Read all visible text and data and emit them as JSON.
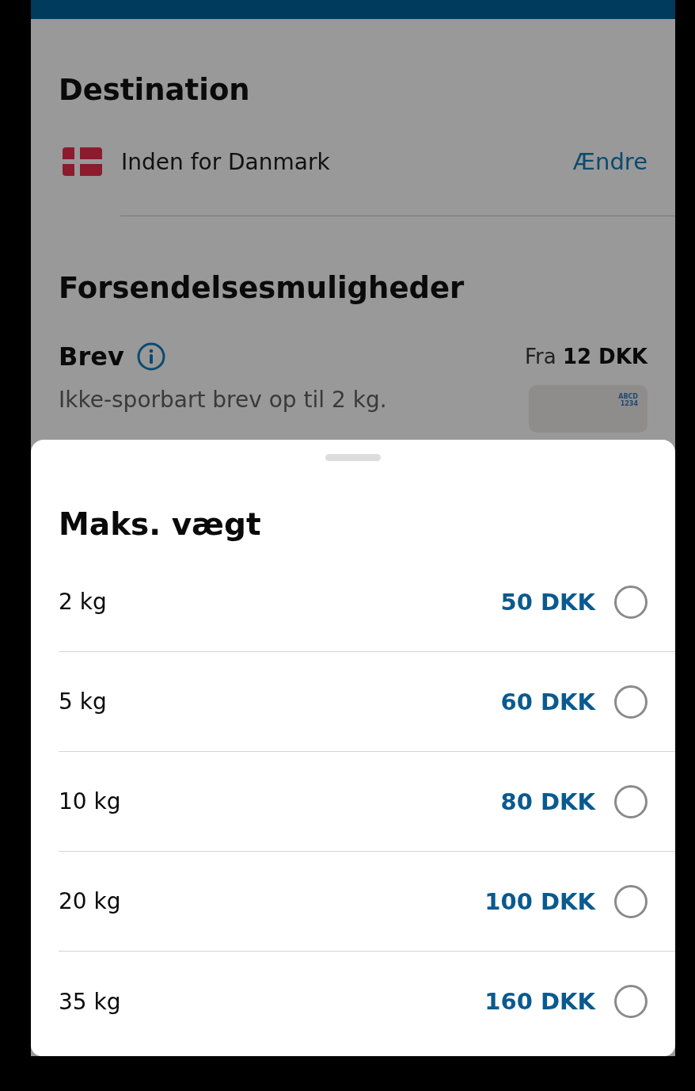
{
  "destination": {
    "title": "Destination",
    "country": "Inden for Danmark",
    "change_link": "Ændre"
  },
  "shipping": {
    "title": "Forsendelsesmuligheder",
    "option": {
      "name": "Brev",
      "price_prefix": "Fra",
      "price": "12 DKK",
      "description": "Ikke-sporbart brev op til 2 kg.",
      "label_lines": [
        "ABCD",
        "1234"
      ]
    }
  },
  "sheet": {
    "title": "Maks. vægt",
    "options": [
      {
        "weight": "2 kg",
        "price": "50 DKK",
        "selected": false
      },
      {
        "weight": "5 kg",
        "price": "60 DKK",
        "selected": false
      },
      {
        "weight": "10 kg",
        "price": "80 DKK",
        "selected": false
      },
      {
        "weight": "20 kg",
        "price": "100 DKK",
        "selected": false
      },
      {
        "weight": "35 kg",
        "price": "160 DKK",
        "selected": false
      }
    ]
  }
}
